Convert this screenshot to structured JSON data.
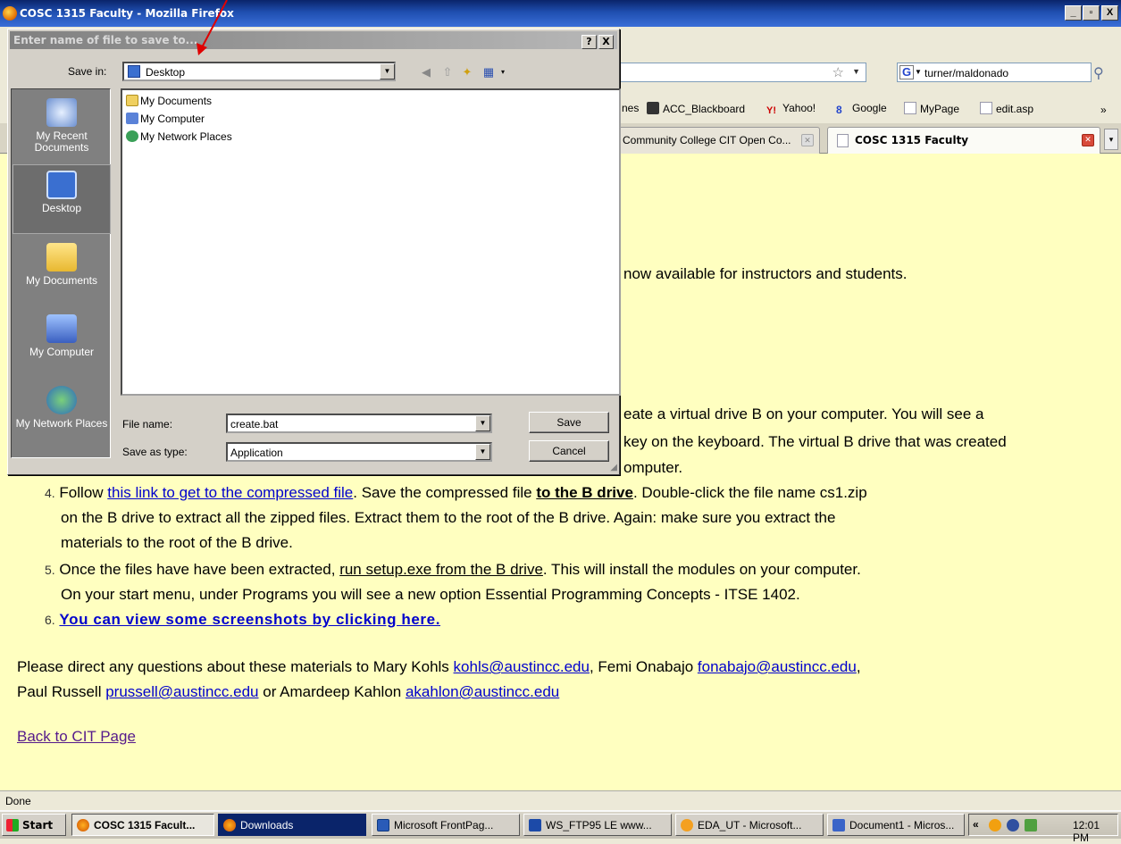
{
  "window": {
    "title": "COSC 1315 Faculty - Mozilla Firefox",
    "controls": [
      "_",
      "▫",
      "X"
    ]
  },
  "navbar": {
    "search_value": "turner/maldonado"
  },
  "bookmarks": [
    "nes",
    "ACC_Blackboard",
    "Yahoo!",
    "Google",
    "MyPage",
    "edit.asp"
  ],
  "bookmarks_more": "»",
  "tabs": [
    {
      "label": "Community College CIT Open Co...",
      "active": false
    },
    {
      "label": "COSC 1315 Faculty",
      "active": true
    }
  ],
  "dialog": {
    "title": "Enter name of file to save to...",
    "help": "?",
    "close": "X",
    "save_in_label": "Save in:",
    "save_in_value": "Desktop",
    "places": [
      "My Recent Documents",
      "Desktop",
      "My Documents",
      "My Computer",
      "My Network Places"
    ],
    "files": [
      "My Documents",
      "My Computer",
      "My Network Places"
    ],
    "file_name_label": "File name:",
    "file_name_value": "create.bat",
    "save_type_label": "Save as type:",
    "save_type_value": "Application",
    "save_button": "Save",
    "cancel_button": "Cancel"
  },
  "page": {
    "line1": "now available for instructors and students.",
    "step3_line1": "eate a virtual drive B on your computer.  You will see a",
    "step3_line2": "key on the keyboard.  The virtual B drive that was created",
    "step3_line3": "omputer.",
    "step4_num": "4.",
    "step4_pre": "Follow ",
    "step4_link": "this link to get to the compressed file",
    "step4_mid": ". Save the compressed file ",
    "step4_bold": "to the B drive",
    "step4_post": ". Double-click the file name cs1.zip",
    "step4_line2": "on the B drive to extract all the zipped files. Extract them to the root of the B drive. Again: make sure you extract the",
    "step4_line3": "materials to the root of the B drive.",
    "step5_num": "5.",
    "step5_pre": "Once the files have have been extracted, ",
    "step5_link": "run setup.exe from the B drive",
    "step5_post": ". This will install the modules on your computer.",
    "step5_line2": "On your start menu, under Programs you will see a new option Essential Programming Concepts - ITSE 1402.",
    "step6_num": "6.",
    "step6_link": "You can view some screenshots by clicking here.",
    "contact_pre": "Please direct any questions about these materials to Mary Kohls ",
    "contact_email1": "kohls@austincc.edu",
    "contact_mid1": ", Femi Onabajo ",
    "contact_email2": "fonabajo@austincc.edu",
    "contact_line2_pre": "Paul Russell ",
    "contact_email3": "prussell@austincc.edu",
    "contact_mid2": " or Amardeep Kahlon ",
    "contact_email4": "akahlon@austincc.edu",
    "back_link": "Back to CIT Page"
  },
  "status": "Done",
  "taskbar": {
    "start": "Start",
    "tasks": [
      "COSC 1315 Facult...",
      "Downloads",
      "Microsoft FrontPag...",
      "WS_FTP95 LE www...",
      "EDA_UT - Microsoft...",
      "Document1 - Micros..."
    ],
    "tray_chevron": "«",
    "clock": "12:01 PM"
  },
  "annotation_color": "#e00000"
}
